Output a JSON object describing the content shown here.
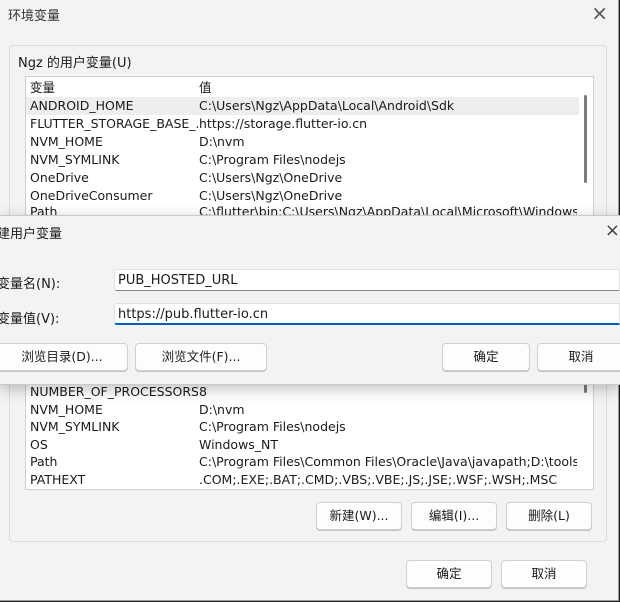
{
  "window": {
    "title": "环境变量",
    "close": "×"
  },
  "user_vars": {
    "group_label": "Ngz 的用户变量(U)",
    "headers": {
      "name": "变量",
      "value": "值"
    },
    "rows": [
      {
        "name": "ANDROID_HOME",
        "value": "C:\\Users\\Ngz\\AppData\\Local\\Android\\Sdk"
      },
      {
        "name": "FLUTTER_STORAGE_BASE_...",
        "value": "https://storage.flutter-io.cn"
      },
      {
        "name": "NVM_HOME",
        "value": "D:\\nvm"
      },
      {
        "name": "NVM_SYMLINK",
        "value": "C:\\Program Files\\nodejs"
      },
      {
        "name": "OneDrive",
        "value": "C:\\Users\\Ngz\\OneDrive"
      },
      {
        "name": "OneDriveConsumer",
        "value": "C:\\Users\\Ngz\\OneDrive"
      },
      {
        "name": "Path",
        "value": "C:\\flutter\\bin;C:\\Users\\Ngz\\AppData\\Local\\Microsoft\\Windows..."
      }
    ]
  },
  "system_vars": {
    "rows": [
      {
        "name": "NUMBER_OF_PROCESSORS",
        "value": "8"
      },
      {
        "name": "NVM_HOME",
        "value": "D:\\nvm"
      },
      {
        "name": "NVM_SYMLINK",
        "value": "C:\\Program Files\\nodejs"
      },
      {
        "name": "OS",
        "value": "Windows_NT"
      },
      {
        "name": "Path",
        "value": "C:\\Program Files\\Common Files\\Oracle\\Java\\javapath;D:\\tools\\..."
      },
      {
        "name": "PATHEXT",
        "value": ".COM;.EXE;.BAT;.CMD;.VBS;.VBE;.JS;.JSE;.WSF;.WSH;.MSC"
      }
    ],
    "buttons": {
      "new": "新建(W)...",
      "edit": "编辑(I)...",
      "delete": "删除(L)"
    }
  },
  "footer": {
    "ok": "确定",
    "cancel": "取消"
  },
  "dialog": {
    "title": "建用户变量",
    "close": "×",
    "name_label": "变量名(N):",
    "name_value": "PUB_HOSTED_URL",
    "value_label": "变量值(V):",
    "value_value": "https://pub.flutter-io.cn",
    "browse_dir": "浏览目录(D)...",
    "browse_file": "浏览文件(F)...",
    "ok": "确定",
    "cancel": "取消"
  }
}
